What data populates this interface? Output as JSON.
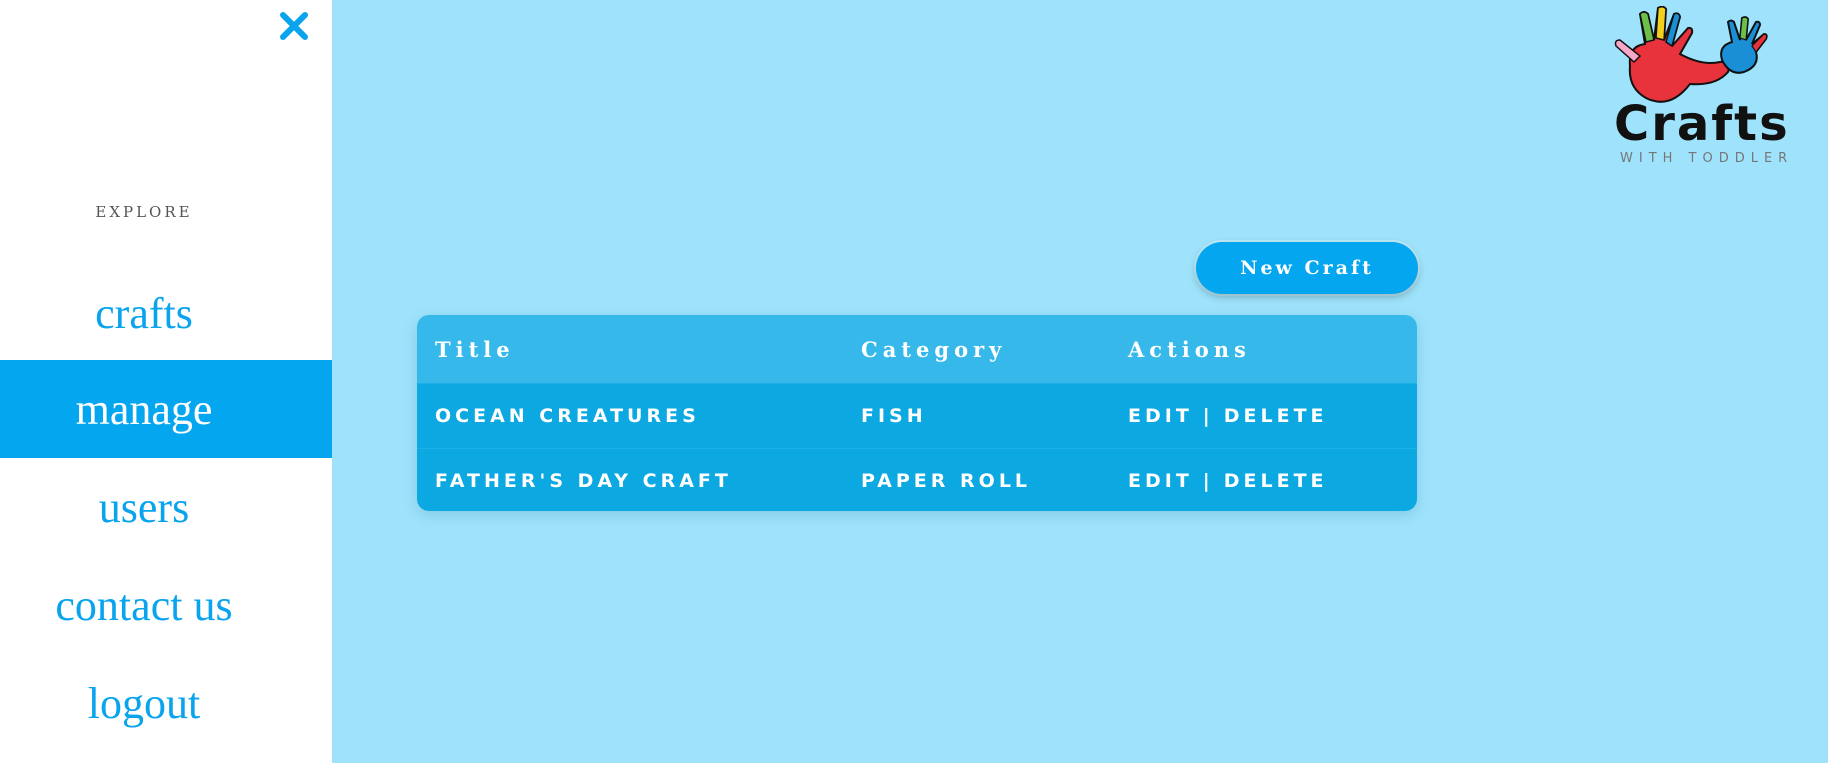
{
  "sidebar": {
    "close_icon": "close-icon",
    "explore_label": "EXPLORE",
    "items": [
      {
        "label": "crafts",
        "active": false
      },
      {
        "label": "manage",
        "active": true
      },
      {
        "label": "users",
        "active": false
      },
      {
        "label": "contact us",
        "active": false
      },
      {
        "label": "logout",
        "active": false
      }
    ]
  },
  "logo": {
    "title": "Crafts",
    "subtitle": "WITH TODDLER",
    "icon": "hands-icon",
    "colors": [
      "#e8323c",
      "#1b8fd6",
      "#f2d01d",
      "#6cc04a",
      "#f7a8c8",
      "#111111"
    ]
  },
  "toolbar": {
    "new_craft_label": "New Craft"
  },
  "table": {
    "columns": [
      "Title",
      "Category",
      "Actions"
    ],
    "rows": [
      {
        "title": "OCEAN CREATURES",
        "category": "FISH",
        "edit": "EDIT",
        "separator": "|",
        "delete": "DELETE"
      },
      {
        "title": "FATHER'S DAY CRAFT",
        "category": "PAPER ROLL",
        "edit": "EDIT",
        "separator": "|",
        "delete": "DELETE"
      }
    ]
  },
  "colors": {
    "page_background": "#9ee3fb",
    "accent": "#05a6f0",
    "table_header": "#36b9ea",
    "table_body": "#0ca8e2"
  }
}
